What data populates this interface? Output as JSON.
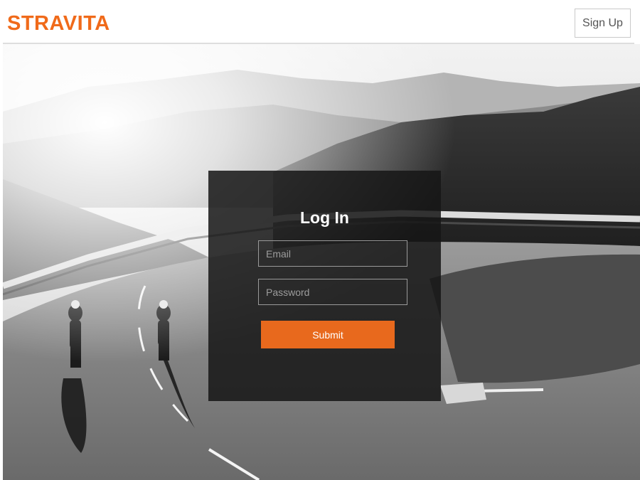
{
  "header": {
    "logo_text": "STRAVITA",
    "signup_label": "Sign Up"
  },
  "login": {
    "title": "Log In",
    "email_placeholder": "Email",
    "password_placeholder": "Password",
    "submit_label": "Submit"
  },
  "colors": {
    "brand": "#f06a1a",
    "submit_bg": "#e8691d",
    "panel_bg": "#161616"
  },
  "hero": {
    "description_icon": "mountain-road-photo"
  }
}
